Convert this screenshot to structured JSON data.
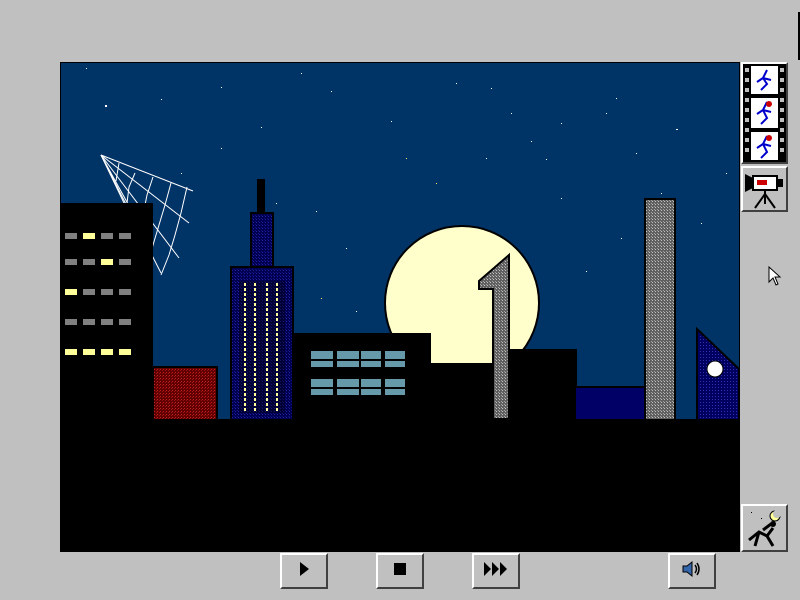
{
  "stage": {
    "scene_name": "night-city-skyline",
    "sky_color": "#003366",
    "moon_color": "#ffffcc",
    "window_color_lit": "#ffff99",
    "window_color_dark": "#808080"
  },
  "sidebar": {
    "filmstrip_icon": "filmstrip-running-man-icon",
    "camera_icon": "movie-camera-icon",
    "night_runner_icon": "night-runner-icon"
  },
  "controls": {
    "play_icon": "play-icon",
    "stop_icon": "stop-icon",
    "fast_forward_icon": "fast-forward-icon",
    "volume_icon": "speaker-icon"
  },
  "colors": {
    "chrome": "#c0c0c0",
    "accent_blue": "#0000cc"
  }
}
